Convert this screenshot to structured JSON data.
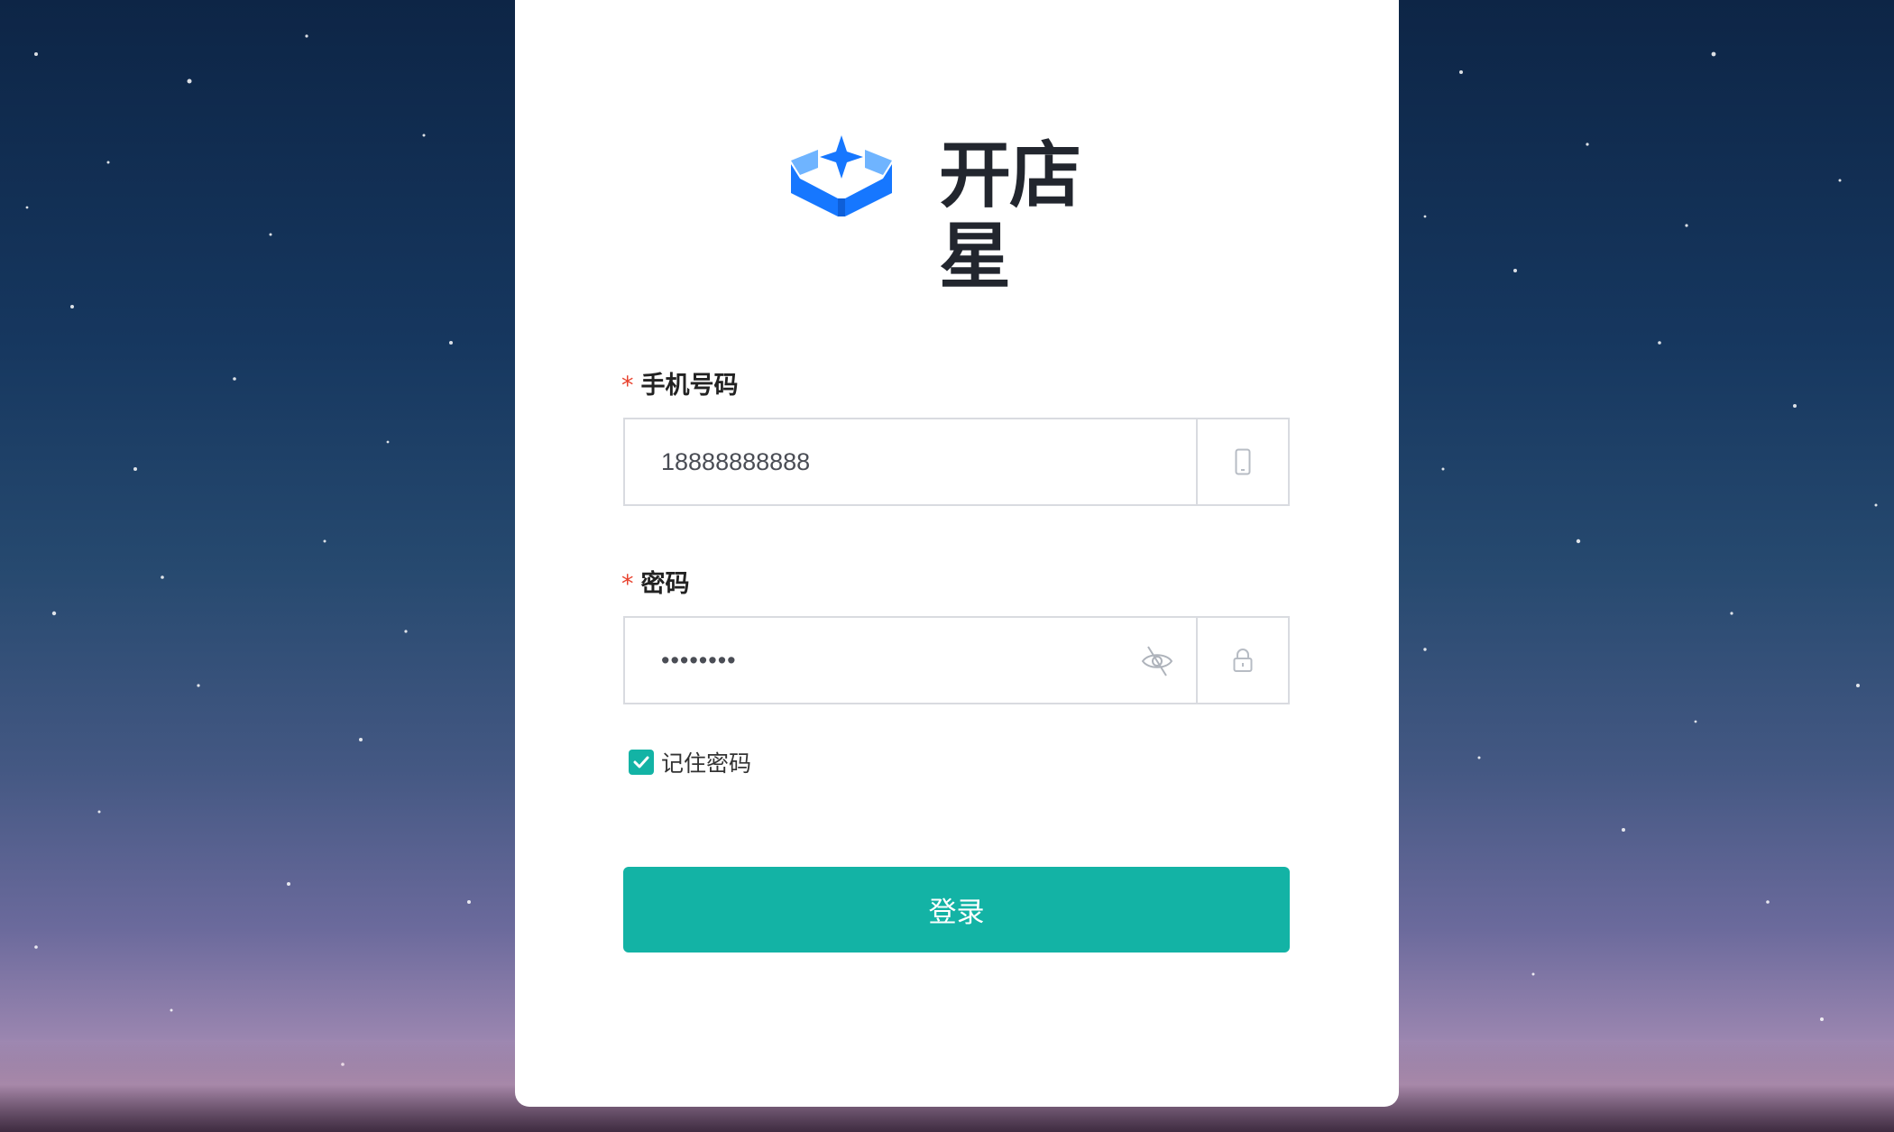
{
  "brand": {
    "name": "开店星",
    "logo_icon": "cube-star-logo-icon",
    "primary_color": "#1677ff"
  },
  "form": {
    "phone": {
      "required_mark": "*",
      "label": "手机号码",
      "value": "18888888888",
      "icon": "mobile-phone-icon"
    },
    "password": {
      "required_mark": "*",
      "label": "密码",
      "value": "••••••••",
      "visibility_icon": "eye-hidden-icon",
      "icon": "lock-icon"
    },
    "remember": {
      "label": "记住密码",
      "checked": true
    },
    "submit_label": "登录"
  },
  "colors": {
    "accent": "#13b3a5",
    "required": "#e8432f",
    "background_top": "#0d2546",
    "background_bottom": "#9b86b0"
  }
}
